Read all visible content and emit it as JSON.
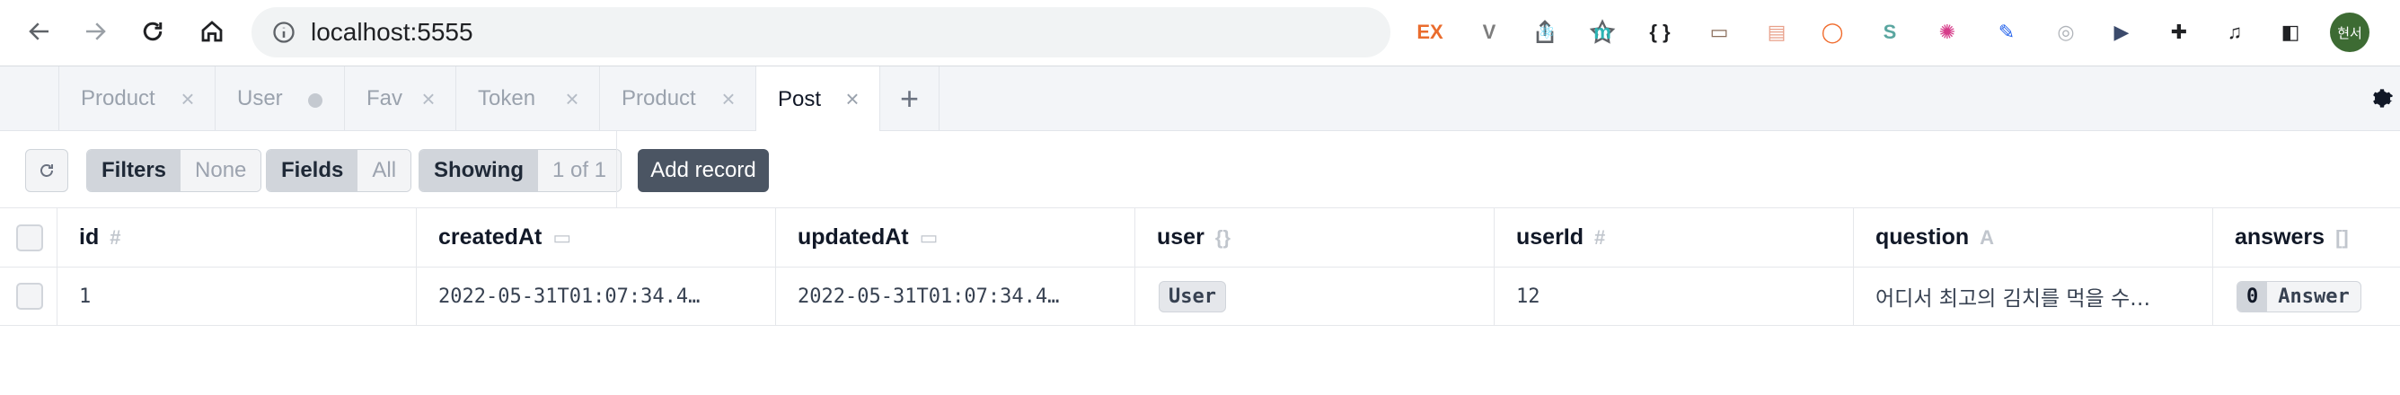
{
  "browser": {
    "url": "localhost:5555",
    "profile_initials": "현서",
    "extensions": [
      {
        "name": "ex-icon",
        "label": "EX",
        "color": "#ea6c2d"
      },
      {
        "name": "vue-devtools-icon",
        "label": "V",
        "color": "#7d7d7d"
      },
      {
        "name": "react-devtools-icon",
        "label": "⚛",
        "color": "#61dafb"
      },
      {
        "name": "m-extension-icon",
        "label": "m",
        "color": "#2bb4b4"
      },
      {
        "name": "json-viewer-icon",
        "label": "{ }",
        "color": "#202124"
      },
      {
        "name": "screen-capture-icon",
        "label": "▭",
        "color": "#8a6d5b"
      },
      {
        "name": "calendar-extension-icon",
        "label": "▤",
        "color": "#e8a08a"
      },
      {
        "name": "color-circle-icon",
        "label": "◯",
        "color": "#f06a2b"
      },
      {
        "name": "s-extension-icon",
        "label": "S",
        "color": "#5aa6a0"
      },
      {
        "name": "color-wheel-icon",
        "label": "✺",
        "color": "#d63c8a"
      },
      {
        "name": "eyedropper-icon",
        "label": "✎",
        "color": "#2563eb"
      },
      {
        "name": "gray-circle-icon",
        "label": "◎",
        "color": "#b0b4b9"
      },
      {
        "name": "sidebar-video-icon",
        "label": "▶",
        "color": "#3b4a6b"
      },
      {
        "name": "puzzle-extensions-icon",
        "label": "✚",
        "color": "#202124"
      },
      {
        "name": "reading-list-icon",
        "label": "♫",
        "color": "#202124"
      },
      {
        "name": "side-panel-icon",
        "label": "◧",
        "color": "#202124"
      }
    ]
  },
  "tabs": [
    {
      "label": "Product",
      "indicator": "close"
    },
    {
      "label": "User",
      "indicator": "dot"
    },
    {
      "label": "Fav",
      "indicator": "close"
    },
    {
      "label": "Token",
      "indicator": "close"
    },
    {
      "label": "Product",
      "indicator": "close"
    },
    {
      "label": "Post",
      "indicator": "close",
      "active": true
    }
  ],
  "tab_add_label": "+",
  "toolbar": {
    "filters_label": "Filters",
    "filters_value": "None",
    "fields_label": "Fields",
    "fields_value": "All",
    "showing_label": "Showing",
    "showing_value": "1 of 1",
    "add_record_label": "Add record"
  },
  "table": {
    "columns": [
      {
        "name": "id",
        "type_glyph": "#"
      },
      {
        "name": "createdAt",
        "type_glyph": "▭"
      },
      {
        "name": "updatedAt",
        "type_glyph": "▭"
      },
      {
        "name": "user",
        "type_glyph": "{}"
      },
      {
        "name": "userId",
        "type_glyph": "#"
      },
      {
        "name": "question",
        "type_glyph": "A"
      },
      {
        "name": "answers",
        "type_glyph": "[]"
      }
    ],
    "rows": [
      {
        "id": "1",
        "createdAt": "2022-05-31T01:07:34.4…",
        "updatedAt": "2022-05-31T01:07:34.4…",
        "user": "User",
        "userId": "12",
        "question": "어디서 최고의 김치를 먹을 수…",
        "answers_count": "0",
        "answers_label": "Answer"
      }
    ]
  }
}
